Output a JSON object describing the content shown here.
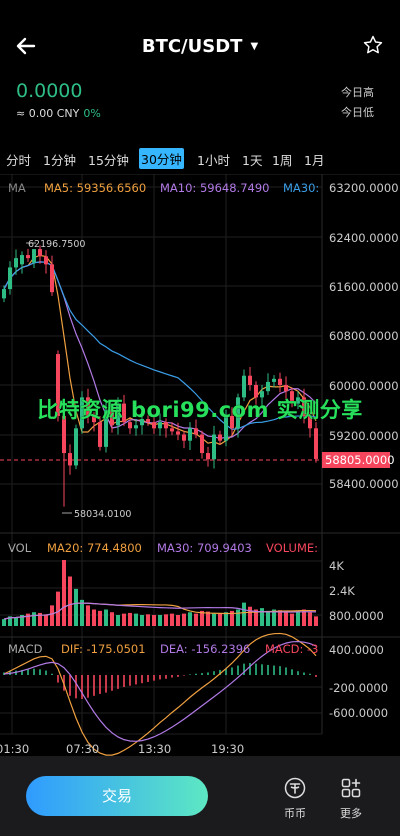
{
  "header": {
    "title": "BTC/USDT",
    "title_caret": "▼",
    "back_icon": "arrow-left-icon",
    "favorite_icon": "star-outline-icon"
  },
  "ticker": {
    "price": "0.0000",
    "cny": "≈ 0.00 CNY",
    "change_pct": "0%",
    "high_label": "今日高",
    "low_label": "今日低"
  },
  "tabs": [
    {
      "label": "分时"
    },
    {
      "label": "1分钟"
    },
    {
      "label": "15分钟"
    },
    {
      "label": "30分钟",
      "active": true
    },
    {
      "label": "1小时"
    },
    {
      "label": "1天"
    },
    {
      "label": "1周"
    },
    {
      "label": "1月"
    }
  ],
  "main_legend": {
    "ma": "MA",
    "ma5": "MA5: 59356.6560",
    "ma10": "MA10: 59648.7490",
    "ma30": "MA30:"
  },
  "indicators": {
    "vol": {
      "label": "VOL",
      "ma20": "MA20: 774.4800",
      "ma30": "MA30: 709.9403",
      "volume": "VOLUME:"
    },
    "macd": {
      "label": "MACD",
      "dif": "DIF: -175.0501",
      "dea": "DEA: -156.2396",
      "macd": "MACD: -3"
    }
  },
  "axes": {
    "price_ticks": [
      "63200.0000",
      "62400.0000",
      "61600.0000",
      "60800.0000",
      "60000.0000",
      "59200.0000",
      "58400.0000"
    ],
    "current_price": "58805.0000",
    "high_marker": "62196.7500",
    "low_marker": "58034.0100",
    "vol_ticks": [
      "4K",
      "2.4K",
      "800.0000"
    ],
    "macd_ticks": [
      "400.0000",
      "-200.0000",
      "-600.0000"
    ],
    "time_ticks": [
      "01:30",
      "07:30",
      "13:30",
      "19:30"
    ]
  },
  "colors": {
    "up": "#2ebd85",
    "down": "#f6465d",
    "ma5": "#f0a040",
    "ma10": "#b27ae6",
    "ma30": "#3a9ee8",
    "accent": "#36b6ff"
  },
  "watermark": "比特资源 bori99.com 实测分享",
  "bottom_bar": {
    "trade_label": "交易",
    "coin_label": "币币",
    "coin_icon": "tether-coin-icon",
    "more_label": "更多",
    "more_icon": "more-grid-icon"
  },
  "chart_data": {
    "type": "candlestick",
    "closes": [
      61550,
      61900,
      62050,
      62100,
      62050,
      62196,
      62080,
      61950,
      61500,
      59500,
      58900,
      58700,
      59300,
      59800,
      59500,
      59400,
      59000,
      59600,
      59350,
      59700,
      59400,
      59300,
      59350,
      59450,
      59400,
      59300,
      59400,
      59300,
      59250,
      59200,
      59100,
      59300,
      59200,
      58900,
      58800,
      59200,
      59100,
      59500,
      59300,
      59800,
      60150,
      60000,
      59800,
      59900,
      60050,
      60100,
      60000,
      59900,
      59700,
      59800,
      59500,
      59300,
      58805
    ],
    "opens": [
      61400,
      61550,
      61900,
      61950,
      62100,
      61980,
      62196,
      62080,
      61950,
      60500,
      59500,
      58900,
      58700,
      59300,
      59800,
      59500,
      59400,
      59000,
      59600,
      59350,
      59700,
      59400,
      59300,
      59350,
      59450,
      59400,
      59300,
      59400,
      59300,
      59250,
      59200,
      59100,
      59300,
      59200,
      58900,
      58800,
      59200,
      59100,
      59500,
      59300,
      59800,
      60150,
      60000,
      59800,
      59900,
      60050,
      60100,
      60000,
      59900,
      59700,
      59800,
      59500,
      59300
    ],
    "volumes": [
      500,
      700,
      650,
      800,
      900,
      1000,
      950,
      850,
      1500,
      2500,
      4800,
      3600,
      2700,
      1900,
      1500,
      1200,
      1100,
      1200,
      1000,
      800,
      900,
      950,
      900,
      800,
      850,
      800,
      800,
      850,
      900,
      800,
      900,
      1000,
      900,
      1100,
      1050,
      900,
      950,
      1000,
      1100,
      1200,
      1700,
      1400,
      1200,
      1300,
      1100,
      1200,
      1150,
      1000,
      900,
      1100,
      1200,
      1000,
      700
    ],
    "macd_hist": [
      40,
      60,
      70,
      80,
      90,
      100,
      90,
      70,
      20,
      -120,
      -250,
      -330,
      -370,
      -380,
      -360,
      -330,
      -300,
      -280,
      -250,
      -220,
      -190,
      -170,
      -150,
      -130,
      -110,
      -90,
      -70,
      -60,
      -40,
      -30,
      -10,
      10,
      20,
      30,
      40,
      60,
      80,
      100,
      120,
      150,
      180,
      190,
      180,
      170,
      160,
      150,
      140,
      120,
      90,
      60,
      40,
      20,
      -30
    ]
  }
}
